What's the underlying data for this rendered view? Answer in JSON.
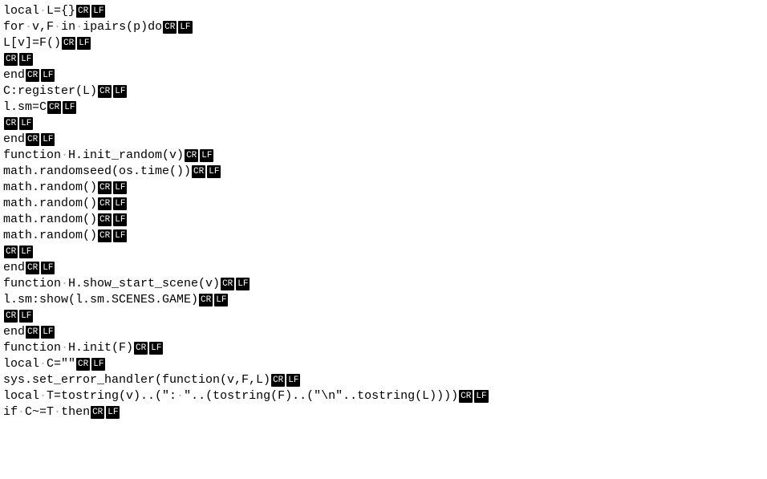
{
  "markers": {
    "cr": "CR",
    "lf": "LF"
  },
  "lines": [
    {
      "tokens": [
        "local",
        " ",
        "L={}"
      ]
    },
    {
      "tokens": [
        "for",
        " ",
        "v,F",
        " ",
        "in",
        " ",
        "ipairs(p)do"
      ]
    },
    {
      "tokens": [
        "L[v]=F()"
      ]
    },
    {
      "tokens": []
    },
    {
      "tokens": [
        "end"
      ]
    },
    {
      "tokens": [
        "C:register(L)"
      ]
    },
    {
      "tokens": [
        "l.sm=C"
      ]
    },
    {
      "tokens": []
    },
    {
      "tokens": [
        "end"
      ]
    },
    {
      "tokens": [
        "function",
        " ",
        "H.init_random(v)"
      ]
    },
    {
      "tokens": [
        "math.randomseed(os.time())"
      ]
    },
    {
      "tokens": [
        "math.random()"
      ]
    },
    {
      "tokens": [
        "math.random()"
      ]
    },
    {
      "tokens": [
        "math.random()"
      ]
    },
    {
      "tokens": [
        "math.random()"
      ]
    },
    {
      "tokens": []
    },
    {
      "tokens": [
        "end"
      ]
    },
    {
      "tokens": [
        "function",
        " ",
        "H.show_start_scene(v)"
      ]
    },
    {
      "tokens": [
        "l.sm:show(l.sm.SCENES.GAME)"
      ]
    },
    {
      "tokens": []
    },
    {
      "tokens": [
        "end"
      ]
    },
    {
      "tokens": [
        "function",
        " ",
        "H.init(F)"
      ]
    },
    {
      "tokens": [
        "local",
        " ",
        "C=\"\""
      ]
    },
    {
      "tokens": [
        "sys.set_error_handler(function(v,F,L)"
      ]
    },
    {
      "tokens": [
        "local",
        " ",
        "T=tostring(v)..(\":",
        " ",
        "\"..(tostring(F)..(\"\\n\"..tostring(L))))"
      ]
    },
    {
      "tokens": [
        "if",
        " ",
        "C~=T",
        " ",
        "then"
      ]
    }
  ]
}
